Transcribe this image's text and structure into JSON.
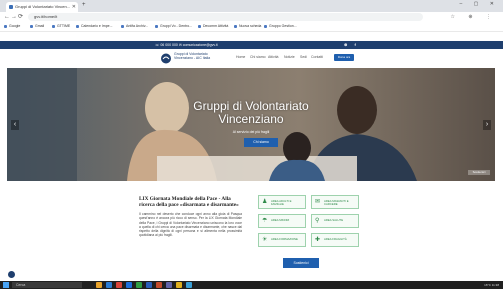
{
  "browser": {
    "tab_title": "Gruppi di Volontariato Vincen...",
    "new_tab": "+",
    "window_controls": "– ▢ ✕",
    "url": "gvv.it/home/it",
    "nav": {
      "back": "←",
      "forward": "→",
      "reload": "⟳",
      "home": "⌂"
    },
    "right_icons": "☆ ⊕ ⋮"
  },
  "bookmarks": [
    "Google",
    "Gmail",
    "GTTIME",
    "Calendario e Impe...",
    "Antifa Archiv...",
    "Gruppi Vo - Dentro...",
    "Decomm Attività",
    "Nuova scheda",
    "Gruppo Gestion..."
  ],
  "site": {
    "contact_text": "☏ 06 000 000   ✉ comunicazione@gvv.it",
    "social_text": "⊛ f",
    "logo_text": "Gruppi di Volontariato Vincenziano - AIC Italia",
    "menu": [
      "Home",
      "Chi siamo",
      "Attività",
      "Notizie",
      "Sedi",
      "Contatti"
    ],
    "donate_label": "Dona ora"
  },
  "hero": {
    "title_line1": "Gruppi di Volontariato",
    "title_line2": "Vincenziano",
    "subtitle": "Al servizio dei più fragili",
    "button_label": "Chi siamo",
    "prev": "‹",
    "next": "›",
    "corner_label": "Sostienici"
  },
  "article": {
    "title": "LIX Giornata Mondiale della Pace - Alla ricerca della pace «disarmata e disarmante»",
    "body": "Il cammino nel deserto che conduce ogni anno alla gioia di Pasqua quest'anno è ancora più ricco di senso. Per la LIX Giornata Mondiale della Pace, i Gruppi di Volontariato Vincenziano uniscono la loro voce a quella di chi cerca una pace disarmata e disarmante, che nasce dal rispetto della dignità di ogni persona e si alimenta nella prossimità quotidiana ai più fragili."
  },
  "cards": [
    {
      "icon": "♟",
      "label": "AREA ADULTI E FAMIGLIE"
    },
    {
      "icon": "✉",
      "label": "AREA MIGRANTI E CARCERE"
    },
    {
      "icon": "☂",
      "label": "AREA MINORI"
    },
    {
      "icon": "⚲",
      "label": "AREA SALUTE"
    },
    {
      "icon": "☀",
      "label": "AREA FORMAZIONE"
    },
    {
      "icon": "✚",
      "label": "AREA FRAGILITÀ"
    }
  ],
  "sostieni_label": "Sostienici",
  "taskbar": {
    "search_placeholder": "Cerca",
    "right_text": "16°C   11:38"
  },
  "colors": {
    "primary": "#1f3f6e",
    "accent": "#1f5fae",
    "card_green": "#2f8a4a"
  }
}
